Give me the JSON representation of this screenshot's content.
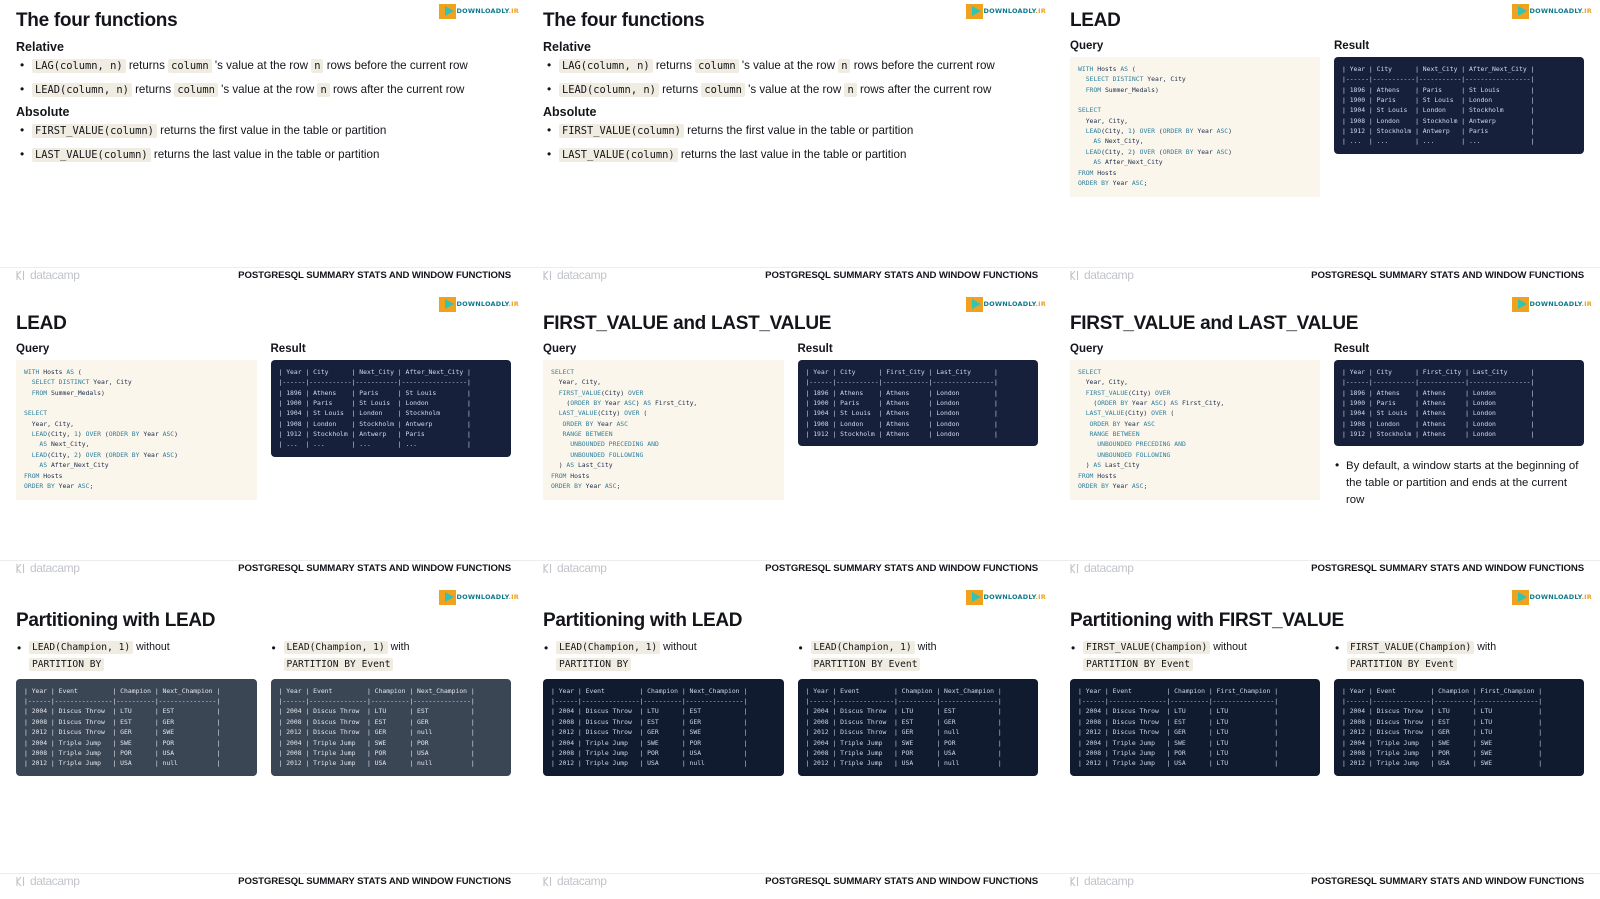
{
  "watermark": {
    "name": "downloadly-watermark",
    "text": "DOWNLOADLY",
    "suffix": ".IR"
  },
  "footer": {
    "brand": "datacamp",
    "course_title": "POSTGRESQL SUMMARY STATS AND WINDOW FUNCTIONS"
  },
  "labels": {
    "query": "Query",
    "result": "Result"
  },
  "slides": [
    {
      "id": "four-functions-a",
      "title": "The four functions",
      "sections": [
        {
          "heading": "Relative",
          "items": [
            {
              "code": "LAG(column, n)",
              "text_a": " returns ",
              "code2": "column",
              "text_b": " 's value at the row ",
              "code3": "n",
              "text_c": " rows before the current row"
            },
            {
              "code": "LEAD(column, n)",
              "text_a": " returns ",
              "code2": "column",
              "text_b": " 's value at the row ",
              "code3": "n",
              "text_c": " rows after the current row"
            }
          ]
        },
        {
          "heading": "Absolute",
          "items": [
            {
              "code": "FIRST_VALUE(column)",
              "text_a": " returns the first value in the table or partition",
              "code2": "",
              "text_b": "",
              "code3": "",
              "text_c": ""
            },
            {
              "code": "LAST_VALUE(column)",
              "text_a": " returns the last value in the table or partition",
              "code2": "",
              "text_b": "",
              "code3": "",
              "text_c": ""
            }
          ]
        }
      ]
    },
    {
      "id": "lead",
      "title": "LEAD",
      "query": "WITH Hosts AS (\n  SELECT DISTINCT Year, City\n  FROM Summer_Medals)\n\nSELECT\n  Year, City,\n  LEAD(City, 1) OVER (ORDER BY Year ASC)\n    AS Next_City,\n  LEAD(City, 2) OVER (ORDER BY Year ASC)\n    AS After_Next_City\nFROM Hosts\nORDER BY Year ASC;",
      "result": "| Year | City      | Next_City | After_Next_City |\n|------|-----------|-----------|-----------------|\n| 1896 | Athens    | Paris     | St Louis        |\n| 1900 | Paris     | St Louis  | London          |\n| 1904 | St Louis  | London    | Stockholm       |\n| 1908 | London    | Stockholm | Antwerp         |\n| 1912 | Stockholm | Antwerp   | Paris           |\n| ...  | ...       | ...       | ...             |"
    },
    {
      "id": "first-last-value",
      "title": "FIRST_VALUE and LAST_VALUE",
      "query": "SELECT\n  Year, City,\n  FIRST_VALUE(City) OVER\n    (ORDER BY Year ASC) AS First_City,\n  LAST_VALUE(City) OVER (\n   ORDER BY Year ASC\n   RANGE BETWEEN\n     UNBOUNDED PRECEDING AND\n     UNBOUNDED FOLLOWING\n  ) AS Last_City\nFROM Hosts\nORDER BY Year ASC;",
      "result": "| Year | City      | First_City | Last_City      |\n|------|-----------|------------|----------------|\n| 1896 | Athens    | Athens     | London         |\n| 1900 | Paris     | Athens     | London         |\n| 1904 | St Louis  | Athens     | London         |\n| 1908 | London    | Athens     | London         |\n| 1912 | Stockholm | Athens     | London         |",
      "note": "By default, a window starts at the beginning of the table or partition and ends at the current row"
    },
    {
      "id": "partitioning-lead",
      "title": "Partitioning with LEAD",
      "left_bullet_code": "LEAD(Champion, 1)",
      "left_bullet_text": " without",
      "left_bullet_line2": "PARTITION BY",
      "right_bullet_code": "LEAD(Champion, 1)",
      "right_bullet_text": " with",
      "right_bullet_line2": "PARTITION BY Event",
      "left_table": "| Year | Event         | Champion | Next_Champion |\n|------|---------------|----------|---------------|\n| 2004 | Discus Throw  | LTU      | EST           |\n| 2008 | Discus Throw  | EST      | GER           |\n| 2012 | Discus Throw  | GER      | SWE           |\n| 2004 | Triple Jump   | SWE      | POR           |\n| 2008 | Triple Jump   | POR      | USA           |\n| 2012 | Triple Jump   | USA      | null          |",
      "right_table": "| Year | Event         | Champion | Next_Champion |\n|------|---------------|----------|---------------|\n| 2004 | Discus Throw  | LTU      | EST           |\n| 2008 | Discus Throw  | EST      | GER           |\n| 2012 | Discus Throw  | GER      | null          |\n| 2004 | Triple Jump   | SWE      | POR           |\n| 2008 | Triple Jump   | POR      | USA           |\n| 2012 | Triple Jump   | USA      | null          |"
    },
    {
      "id": "partitioning-first-value",
      "title": "Partitioning with FIRST_VALUE",
      "left_bullet_code": "FIRST_VALUE(Champion)",
      "left_bullet_text": " without",
      "left_bullet_line2": "PARTITION BY Event",
      "right_bullet_code": "FIRST_VALUE(Champion)",
      "right_bullet_text": " with",
      "right_bullet_line2": "PARTITION BY Event",
      "left_table": "| Year | Event         | Champion | First_Champion |\n|------|---------------|----------|----------------|\n| 2004 | Discus Throw  | LTU      | LTU            |\n| 2008 | Discus Throw  | EST      | LTU            |\n| 2012 | Discus Throw  | GER      | LTU            |\n| 2004 | Triple Jump   | SWE      | LTU            |\n| 2008 | Triple Jump   | POR      | LTU            |\n| 2012 | Triple Jump   | USA      | LTU            |",
      "right_table": "| Year | Event         | Champion | First_Champion |\n|------|---------------|----------|----------------|\n| 2004 | Discus Throw  | LTU      | LTU            |\n| 2008 | Discus Throw  | EST      | LTU            |\n| 2012 | Discus Throw  | GER      | LTU            |\n| 2004 | Triple Jump   | SWE      | SWE            |\n| 2008 | Triple Jump   | POR      | SWE            |\n| 2012 | Triple Jump   | USA      | SWE            |"
    }
  ],
  "colors": {
    "code_bg": "#faf6ec",
    "code_fg": "#1d2b4a",
    "code_keyword": "#2d7f9d",
    "result_bg": "#16203a",
    "result_fg": "#cfd9ee",
    "slate_table_bg": "#3b4654",
    "text": "#13151a",
    "watermark_orange": "#f0a21e",
    "watermark_teal": "#31c3b4",
    "footer_brand": "#9aa0a8"
  }
}
